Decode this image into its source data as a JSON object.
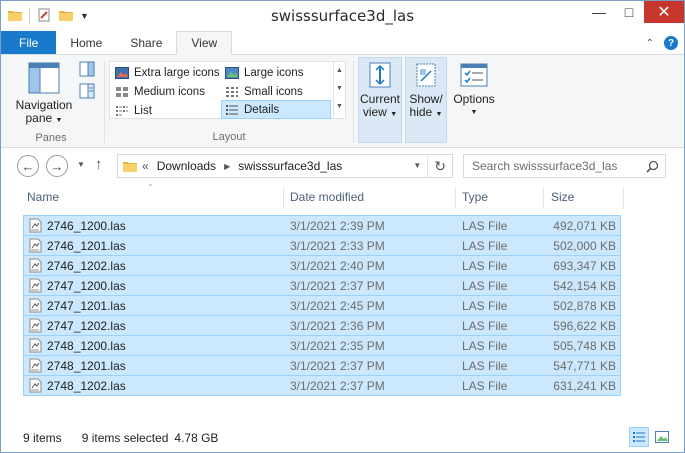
{
  "window": {
    "title": "swisssurface3d_las"
  },
  "ribbon_tabs": [
    "File",
    "Home",
    "Share",
    "View"
  ],
  "ribbon": {
    "panes": {
      "navigation_pane_line1": "Navigation",
      "navigation_pane_line2": "pane",
      "group_label": "Panes"
    },
    "layout": {
      "items": [
        "Extra large icons",
        "Large icons",
        "Medium icons",
        "Small icons",
        "List",
        "Details"
      ],
      "selected": "Details",
      "group_label": "Layout"
    },
    "current_view_line1": "Current",
    "current_view_line2": "view",
    "show_hide_line1": "Show/",
    "show_hide_line2": "hide",
    "options_label": "Options"
  },
  "address": {
    "overflow": "«",
    "crumbs": [
      "Downloads",
      "swisssurface3d_las"
    ],
    "search_placeholder": "Search swisssurface3d_las"
  },
  "columns": [
    "Name",
    "Date modified",
    "Type",
    "Size"
  ],
  "files": [
    {
      "name": "2746_1200.las",
      "date": "3/1/2021 2:39 PM",
      "type": "LAS File",
      "size": "492,071 KB"
    },
    {
      "name": "2746_1201.las",
      "date": "3/1/2021 2:33 PM",
      "type": "LAS File",
      "size": "502,000 KB"
    },
    {
      "name": "2746_1202.las",
      "date": "3/1/2021 2:40 PM",
      "type": "LAS File",
      "size": "693,347 KB"
    },
    {
      "name": "2747_1200.las",
      "date": "3/1/2021 2:37 PM",
      "type": "LAS File",
      "size": "542,154 KB"
    },
    {
      "name": "2747_1201.las",
      "date": "3/1/2021 2:45 PM",
      "type": "LAS File",
      "size": "502,878 KB"
    },
    {
      "name": "2747_1202.las",
      "date": "3/1/2021 2:36 PM",
      "type": "LAS File",
      "size": "596,622 KB"
    },
    {
      "name": "2748_1200.las",
      "date": "3/1/2021 2:35 PM",
      "type": "LAS File",
      "size": "505,748 KB"
    },
    {
      "name": "2748_1201.las",
      "date": "3/1/2021 2:37 PM",
      "type": "LAS File",
      "size": "547,771 KB"
    },
    {
      "name": "2748_1202.las",
      "date": "3/1/2021 2:37 PM",
      "type": "LAS File",
      "size": "631,241 KB"
    }
  ],
  "status": {
    "item_count": "9 items",
    "selected": "9 items selected",
    "selected_size": "4.78 GB"
  },
  "colors": {
    "accent": "#1979ca",
    "selection_bg": "#cce8ff",
    "selection_border": "#99d1ff",
    "close_button": "#c7362a"
  }
}
